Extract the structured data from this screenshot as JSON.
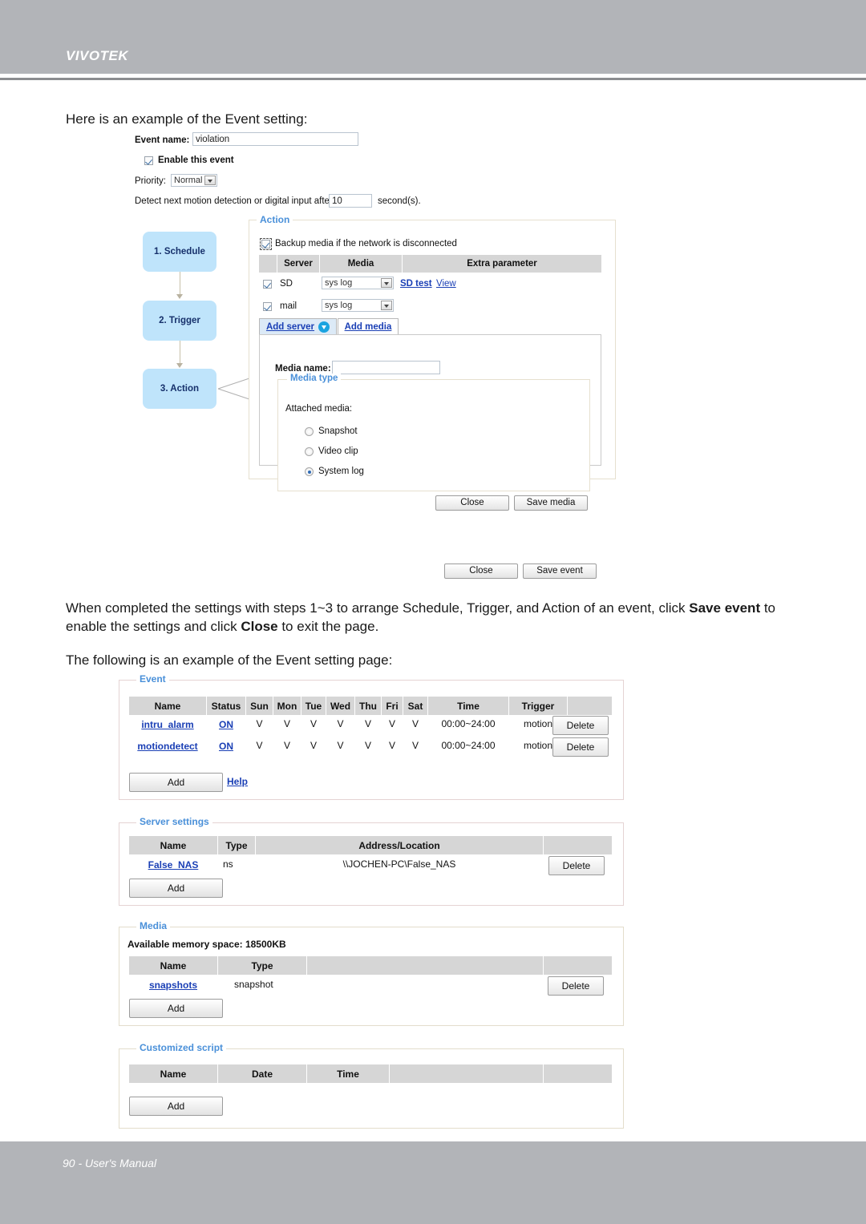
{
  "header": {
    "brand": "VIVOTEK"
  },
  "footer": {
    "text": "90 - User's Manual"
  },
  "intro": {
    "line1": "Here is an example of the Event setting:"
  },
  "midtext": {
    "p1_a": "When completed the settings with steps 1~3 to arrange Schedule, Trigger, and Action of an event, click ",
    "p1_b": "Save event",
    "p1_c": " to enable the settings and click ",
    "p1_d": "Close",
    "p1_e": " to exit the page.",
    "p2": "The following is an example of the Event setting page:"
  },
  "dialog": {
    "event_name_label": "Event name:",
    "event_name_value": "violation",
    "enable_label": "Enable this event",
    "enable_checked": true,
    "priority_label": "Priority:",
    "priority_value": "Normal",
    "priority_options": [
      "Normal"
    ],
    "detect_label_a": "Detect next motion detection or digital input after",
    "detect_value": "10",
    "detect_label_b": "second(s).",
    "steps": [
      {
        "label": "1.  Schedule"
      },
      {
        "label": "2.  Trigger"
      },
      {
        "label": "3.  Action"
      }
    ],
    "action": {
      "legend": "Action",
      "backup_label": "Backup media if the network is disconnected",
      "backup_checked": true,
      "columns": [
        "",
        "Server",
        "Media",
        "Extra parameter"
      ],
      "rows": [
        {
          "checked": true,
          "server": "SD",
          "media": "sys log",
          "extra": [
            "SD test",
            "View"
          ]
        },
        {
          "checked": true,
          "server": "mail",
          "media": "sys log",
          "extra": []
        }
      ],
      "tabs": [
        {
          "label": "Add server",
          "active": true,
          "has_badge": true
        },
        {
          "label": "Add media",
          "active": false,
          "has_badge": false
        }
      ],
      "media_name_label": "Media name:",
      "media_name_value": "",
      "media_type": {
        "legend": "Media type",
        "attached_label": "Attached media:",
        "options": [
          {
            "label": "Snapshot",
            "selected": false
          },
          {
            "label": "Video clip",
            "selected": false
          },
          {
            "label": "System log",
            "selected": true
          }
        ]
      },
      "media_buttons": {
        "close": "Close",
        "save": "Save media"
      }
    },
    "event_buttons": {
      "close": "Close",
      "save": "Save event"
    }
  },
  "settings_page": {
    "event": {
      "legend": "Event",
      "columns": [
        "Name",
        "Status",
        "Sun",
        "Mon",
        "Tue",
        "Wed",
        "Thu",
        "Fri",
        "Sat",
        "Time",
        "Trigger",
        ""
      ],
      "rows": [
        {
          "name": "intru_alarm",
          "status": "ON",
          "days": [
            "V",
            "V",
            "V",
            "V",
            "V",
            "V",
            "V"
          ],
          "time": "00:00~24:00",
          "trigger": "motion",
          "delete": "Delete"
        },
        {
          "name": "motiondetect",
          "status": "ON",
          "days": [
            "V",
            "V",
            "V",
            "V",
            "V",
            "V",
            "V"
          ],
          "time": "00:00~24:00",
          "trigger": "motion",
          "delete": "Delete"
        }
      ],
      "add": "Add",
      "help": "Help"
    },
    "server": {
      "legend": "Server settings",
      "columns": [
        "Name",
        "Type",
        "Address/Location",
        ""
      ],
      "rows": [
        {
          "name": "False_NAS",
          "type": "ns",
          "address": "\\\\JOCHEN-PC\\False_NAS",
          "delete": "Delete"
        }
      ],
      "add": "Add"
    },
    "media": {
      "legend": "Media",
      "memory": "Available memory space: 18500KB",
      "columns": [
        "Name",
        "Type",
        "",
        ""
      ],
      "rows": [
        {
          "name": "snapshots",
          "type": "snapshot",
          "delete": "Delete"
        }
      ],
      "add": "Add"
    },
    "script": {
      "legend": "Customized script",
      "columns": [
        "Name",
        "Date",
        "Time",
        "",
        ""
      ],
      "rows": [],
      "add": "Add"
    }
  }
}
